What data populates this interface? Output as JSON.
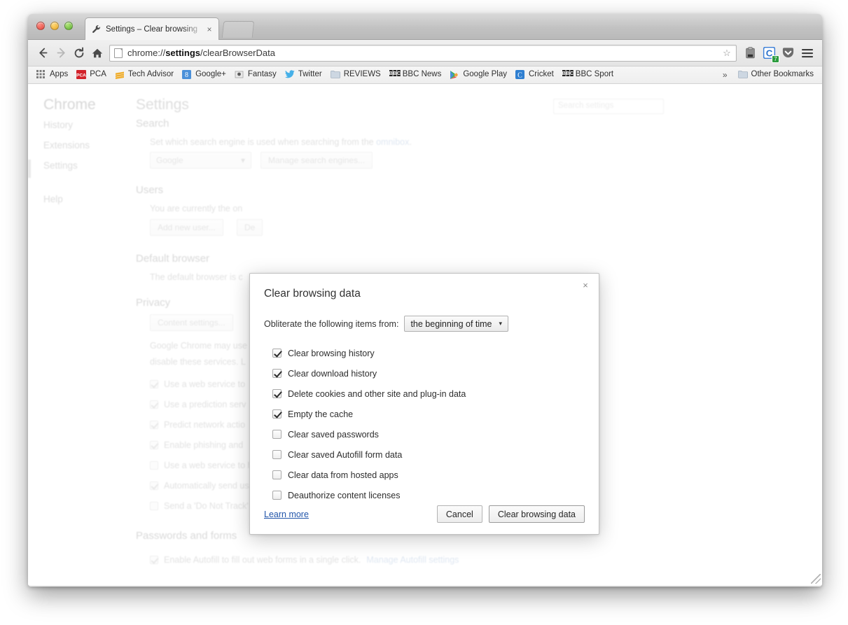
{
  "window": {
    "traffic_lights": [
      "close",
      "minimize",
      "zoom"
    ]
  },
  "tab": {
    "title": "Settings – Clear browsing",
    "close_label": "×",
    "favicon": "wrench-icon"
  },
  "toolbar": {
    "back": "←",
    "forward": "→",
    "reload": "⟳",
    "home": "⌂",
    "url_prefix": "chrome://",
    "url_bold": "settings",
    "url_suffix": "/clearBrowserData",
    "star": "☆",
    "icons": [
      "clipboard-icon",
      "chrome-extension-c-icon",
      "pocket-icon",
      "chrome-menu-icon"
    ],
    "extension_badge": "7"
  },
  "bookmarks": {
    "items": [
      {
        "label": "Apps",
        "icon": "apps-grid-icon"
      },
      {
        "label": "PCA",
        "icon": "pca-icon"
      },
      {
        "label": "Tech Advisor",
        "icon": "techadvisor-icon"
      },
      {
        "label": "Google+",
        "icon": "googleplus-icon"
      },
      {
        "label": "Fantasy",
        "icon": "fantasy-icon"
      },
      {
        "label": "Twitter",
        "icon": "twitter-icon"
      },
      {
        "label": "REVIEWS",
        "icon": "folder-icon"
      },
      {
        "label": "BBC News",
        "icon": "bbc-icon"
      },
      {
        "label": "Google Play",
        "icon": "googleplay-icon"
      },
      {
        "label": "Cricket",
        "icon": "cricket-c-icon"
      },
      {
        "label": "BBC Sport",
        "icon": "bbc-icon"
      }
    ],
    "overflow": "»",
    "other_bookmarks": {
      "label": "Other Bookmarks",
      "icon": "folder-icon"
    }
  },
  "settings_page": {
    "brand": "Chrome",
    "nav": [
      {
        "label": "History"
      },
      {
        "label": "Extensions"
      },
      {
        "label": "Settings"
      },
      {
        "label": "Help"
      }
    ],
    "title": "Settings",
    "search_placeholder": "Search settings",
    "sections": {
      "search": {
        "heading": "Search",
        "description_before": "Set which search engine is used when searching from the ",
        "description_link": "omnibox",
        "description_after": ".",
        "engine_value": "Google",
        "manage_button": "Manage search engines..."
      },
      "users": {
        "heading": "Users",
        "description": "You are currently the on",
        "add_user_button": "Add new user...",
        "second_button": "De"
      },
      "default_browser": {
        "heading": "Default browser",
        "description": "The default browser is c"
      },
      "privacy": {
        "heading": "Privacy",
        "content_settings_button": "Content settings...",
        "description_line1": "Google Chrome may use",
        "description_line2": "disable these services. L",
        "checkboxes": [
          {
            "label": "Use a web service to",
            "checked": true
          },
          {
            "label": "Use a prediction serv",
            "checked": true
          },
          {
            "label": "Predict network actio",
            "checked": true
          },
          {
            "label": "Enable phishing and",
            "checked": true
          },
          {
            "label": "Use a web service to help resolve spelling errors",
            "checked": false
          },
          {
            "label": "Automatically send usage statistics and crash reports to Google",
            "checked": true
          },
          {
            "label": "Send a 'Do Not Track' request with your browsing traffic",
            "checked": false
          }
        ]
      },
      "passwords": {
        "heading": "Passwords and forms",
        "autofill_label": "Enable Autofill to fill out web forms in a single click.",
        "autofill_link": "Manage Autofill settings"
      }
    }
  },
  "dialog": {
    "title": "Clear browsing data",
    "close": "×",
    "period_label": "Obliterate the following items from:",
    "period_value": "the beginning of time",
    "period_caret": "▾",
    "options": [
      {
        "label": "Clear browsing history",
        "checked": true
      },
      {
        "label": "Clear download history",
        "checked": true
      },
      {
        "label": "Delete cookies and other site and plug-in data",
        "checked": true
      },
      {
        "label": "Empty the cache",
        "checked": true
      },
      {
        "label": "Clear saved passwords",
        "checked": false
      },
      {
        "label": "Clear saved Autofill form data",
        "checked": false
      },
      {
        "label": "Clear data from hosted apps",
        "checked": false
      },
      {
        "label": "Deauthorize content licenses",
        "checked": false
      }
    ],
    "learn_more": "Learn more",
    "cancel_button": "Cancel",
    "confirm_button": "Clear browsing data"
  },
  "colors": {
    "link": "#2255aa",
    "dialog_bg": "#ffffff",
    "toolbar_bg": "#e8e8e8"
  }
}
